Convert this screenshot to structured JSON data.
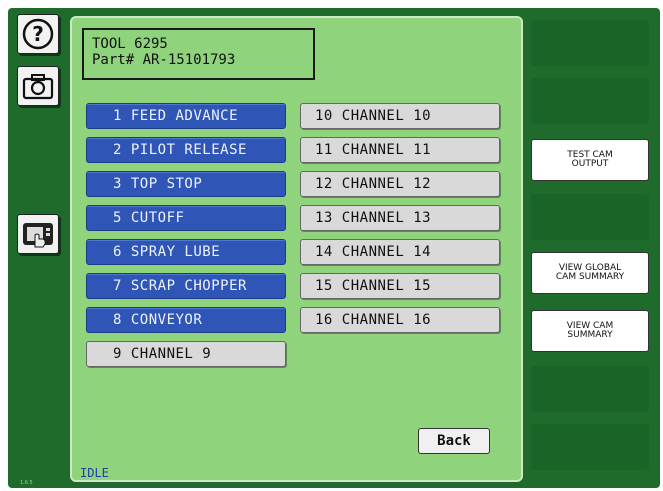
{
  "header": {
    "tool_line": "TOOL 6295",
    "part_line": "Part# AR-15101793"
  },
  "left_toolbar": {
    "help_icon": "question-icon",
    "camera_icon": "camera-icon",
    "device_icon": "touch-panel-icon",
    "version": "1.6.5"
  },
  "cam_buttons_left": [
    {
      "label": "1 FEED ADVANCE"
    },
    {
      "label": "2 PILOT RELEASE"
    },
    {
      "label": "3 TOP STOP"
    },
    {
      "label": "5 CUTOFF"
    },
    {
      "label": "6 SPRAY LUBE"
    },
    {
      "label": "7 SCRAP CHOPPER"
    },
    {
      "label": "8 CONVEYOR"
    },
    {
      "label": "9 CHANNEL 9"
    }
  ],
  "cam_buttons_right": [
    {
      "label": "10 CHANNEL 10"
    },
    {
      "label": "11 CHANNEL 11"
    },
    {
      "label": "12 CHANNEL 12"
    },
    {
      "label": "13 CHANNEL 13"
    },
    {
      "label": "14 CHANNEL 14"
    },
    {
      "label": "15 CHANNEL 15"
    },
    {
      "label": "16 CHANNEL 16"
    }
  ],
  "back_label": "Back",
  "status": "IDLE",
  "side_buttons": {
    "test_cam_output": "TEST CAM\nOUTPUT",
    "view_global_cam_summary": "VIEW GLOBAL\nCAM SUMMARY",
    "view_cam_summary": "VIEW CAM\nSUMMARY"
  },
  "colors": {
    "frame": "#1f6b2c",
    "panel": "#8fd37c",
    "active_button": "#2f56b6",
    "inactive_button": "#d9d9d9",
    "status_text": "#1f3fa8"
  }
}
